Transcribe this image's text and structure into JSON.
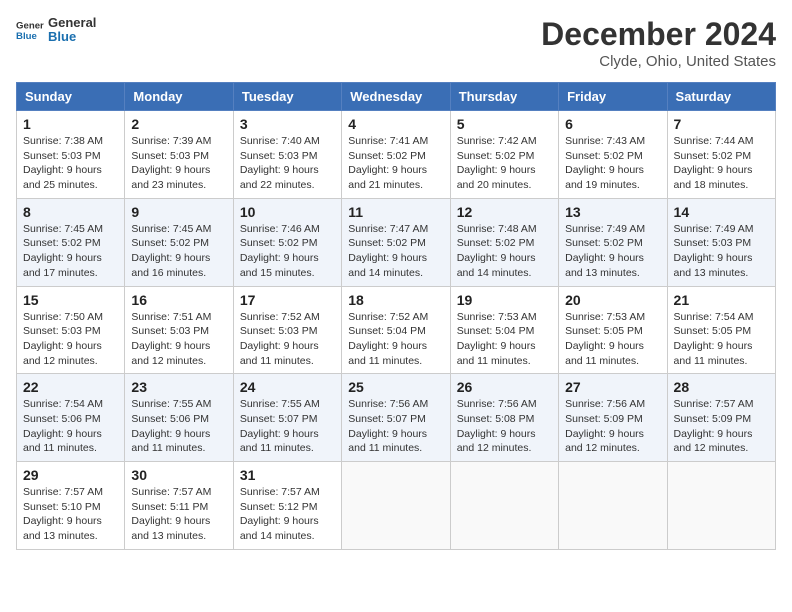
{
  "header": {
    "logo_line1": "General",
    "logo_line2": "Blue",
    "title": "December 2024",
    "subtitle": "Clyde, Ohio, United States"
  },
  "calendar": {
    "days_of_week": [
      "Sunday",
      "Monday",
      "Tuesday",
      "Wednesday",
      "Thursday",
      "Friday",
      "Saturday"
    ],
    "weeks": [
      [
        {
          "day": "1",
          "info": "Sunrise: 7:38 AM\nSunset: 5:03 PM\nDaylight: 9 hours and 25 minutes."
        },
        {
          "day": "2",
          "info": "Sunrise: 7:39 AM\nSunset: 5:03 PM\nDaylight: 9 hours and 23 minutes."
        },
        {
          "day": "3",
          "info": "Sunrise: 7:40 AM\nSunset: 5:03 PM\nDaylight: 9 hours and 22 minutes."
        },
        {
          "day": "4",
          "info": "Sunrise: 7:41 AM\nSunset: 5:02 PM\nDaylight: 9 hours and 21 minutes."
        },
        {
          "day": "5",
          "info": "Sunrise: 7:42 AM\nSunset: 5:02 PM\nDaylight: 9 hours and 20 minutes."
        },
        {
          "day": "6",
          "info": "Sunrise: 7:43 AM\nSunset: 5:02 PM\nDaylight: 9 hours and 19 minutes."
        },
        {
          "day": "7",
          "info": "Sunrise: 7:44 AM\nSunset: 5:02 PM\nDaylight: 9 hours and 18 minutes."
        }
      ],
      [
        {
          "day": "8",
          "info": "Sunrise: 7:45 AM\nSunset: 5:02 PM\nDaylight: 9 hours and 17 minutes."
        },
        {
          "day": "9",
          "info": "Sunrise: 7:45 AM\nSunset: 5:02 PM\nDaylight: 9 hours and 16 minutes."
        },
        {
          "day": "10",
          "info": "Sunrise: 7:46 AM\nSunset: 5:02 PM\nDaylight: 9 hours and 15 minutes."
        },
        {
          "day": "11",
          "info": "Sunrise: 7:47 AM\nSunset: 5:02 PM\nDaylight: 9 hours and 14 minutes."
        },
        {
          "day": "12",
          "info": "Sunrise: 7:48 AM\nSunset: 5:02 PM\nDaylight: 9 hours and 14 minutes."
        },
        {
          "day": "13",
          "info": "Sunrise: 7:49 AM\nSunset: 5:02 PM\nDaylight: 9 hours and 13 minutes."
        },
        {
          "day": "14",
          "info": "Sunrise: 7:49 AM\nSunset: 5:03 PM\nDaylight: 9 hours and 13 minutes."
        }
      ],
      [
        {
          "day": "15",
          "info": "Sunrise: 7:50 AM\nSunset: 5:03 PM\nDaylight: 9 hours and 12 minutes."
        },
        {
          "day": "16",
          "info": "Sunrise: 7:51 AM\nSunset: 5:03 PM\nDaylight: 9 hours and 12 minutes."
        },
        {
          "day": "17",
          "info": "Sunrise: 7:52 AM\nSunset: 5:03 PM\nDaylight: 9 hours and 11 minutes."
        },
        {
          "day": "18",
          "info": "Sunrise: 7:52 AM\nSunset: 5:04 PM\nDaylight: 9 hours and 11 minutes."
        },
        {
          "day": "19",
          "info": "Sunrise: 7:53 AM\nSunset: 5:04 PM\nDaylight: 9 hours and 11 minutes."
        },
        {
          "day": "20",
          "info": "Sunrise: 7:53 AM\nSunset: 5:05 PM\nDaylight: 9 hours and 11 minutes."
        },
        {
          "day": "21",
          "info": "Sunrise: 7:54 AM\nSunset: 5:05 PM\nDaylight: 9 hours and 11 minutes."
        }
      ],
      [
        {
          "day": "22",
          "info": "Sunrise: 7:54 AM\nSunset: 5:06 PM\nDaylight: 9 hours and 11 minutes."
        },
        {
          "day": "23",
          "info": "Sunrise: 7:55 AM\nSunset: 5:06 PM\nDaylight: 9 hours and 11 minutes."
        },
        {
          "day": "24",
          "info": "Sunrise: 7:55 AM\nSunset: 5:07 PM\nDaylight: 9 hours and 11 minutes."
        },
        {
          "day": "25",
          "info": "Sunrise: 7:56 AM\nSunset: 5:07 PM\nDaylight: 9 hours and 11 minutes."
        },
        {
          "day": "26",
          "info": "Sunrise: 7:56 AM\nSunset: 5:08 PM\nDaylight: 9 hours and 12 minutes."
        },
        {
          "day": "27",
          "info": "Sunrise: 7:56 AM\nSunset: 5:09 PM\nDaylight: 9 hours and 12 minutes."
        },
        {
          "day": "28",
          "info": "Sunrise: 7:57 AM\nSunset: 5:09 PM\nDaylight: 9 hours and 12 minutes."
        }
      ],
      [
        {
          "day": "29",
          "info": "Sunrise: 7:57 AM\nSunset: 5:10 PM\nDaylight: 9 hours and 13 minutes."
        },
        {
          "day": "30",
          "info": "Sunrise: 7:57 AM\nSunset: 5:11 PM\nDaylight: 9 hours and 13 minutes."
        },
        {
          "day": "31",
          "info": "Sunrise: 7:57 AM\nSunset: 5:12 PM\nDaylight: 9 hours and 14 minutes."
        },
        {
          "day": "",
          "info": ""
        },
        {
          "day": "",
          "info": ""
        },
        {
          "day": "",
          "info": ""
        },
        {
          "day": "",
          "info": ""
        }
      ]
    ]
  }
}
